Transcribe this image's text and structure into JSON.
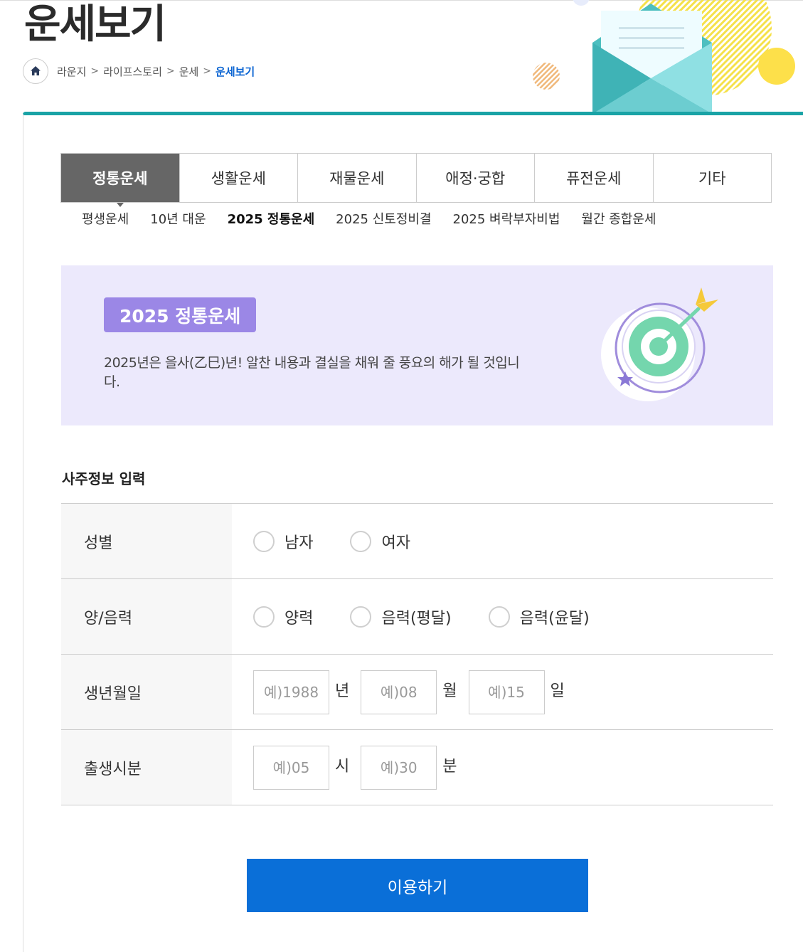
{
  "page": {
    "title": "운세보기"
  },
  "breadcrumb": {
    "items": [
      "라운지",
      "라이프스토리",
      "운세",
      "운세보기"
    ]
  },
  "tabs": [
    "정통운세",
    "생활운세",
    "재물운세",
    "애정·궁합",
    "퓨전운세",
    "기타"
  ],
  "active_tab": "정통운세",
  "subtabs": [
    "평생운세",
    "10년 대운",
    "2025 정통운세",
    "2025 신토정비결",
    "2025 벼락부자비법",
    "월간 종합운세"
  ],
  "active_subtab": "2025 정통운세",
  "banner": {
    "badge": "2025 정통운세",
    "description": "2025년은 을사(乙巳)년! 알찬 내용과 결실을 채워 줄 풍요의 해가 될 것입니다."
  },
  "form": {
    "section_title": "사주정보 입력",
    "gender": {
      "label": "성별",
      "options": [
        "남자",
        "여자"
      ]
    },
    "calendar": {
      "label": "양/음력",
      "options": [
        "양력",
        "음력(평달)",
        "음력(윤달)"
      ]
    },
    "birthdate": {
      "label": "생년월일",
      "year_placeholder": "예)1988",
      "year_unit": "년",
      "month_placeholder": "예)08",
      "month_unit": "월",
      "day_placeholder": "예)15",
      "day_unit": "일"
    },
    "birthtime": {
      "label": "출생시분",
      "hour_placeholder": "예)05",
      "hour_unit": "시",
      "minute_placeholder": "예)30",
      "minute_unit": "분"
    }
  },
  "submit_label": "이용하기",
  "colors": {
    "accent_teal": "#19a3a6",
    "active_tab_bg": "#666666",
    "banner_bg": "#ece9fc",
    "badge_purple": "#9b87e6",
    "button_blue": "#0a6fd8",
    "breadcrumb_current": "#0a64d2"
  },
  "icons": {
    "home": "home-icon",
    "breadcrumb_separator": "chevron-right-icon",
    "header_illustration": "envelope-illustration",
    "banner_illustration": "target-arrow-illustration"
  }
}
